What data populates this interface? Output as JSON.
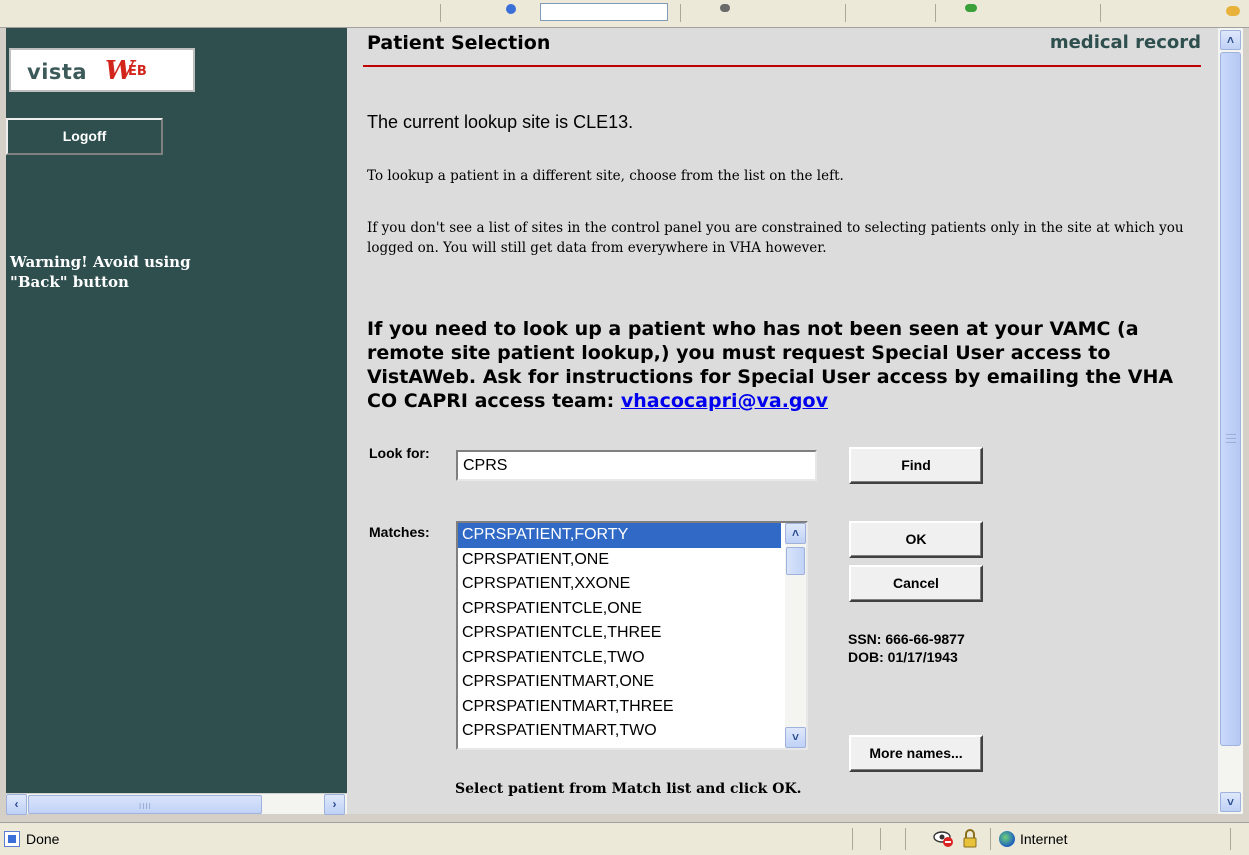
{
  "left_panel": {
    "logo": {
      "part1": "vista",
      "part2": "W",
      "part3": "EB"
    },
    "logoff_label": "Logoff",
    "warning_line1": "Warning! Avoid using",
    "warning_line2": "\"Back\" button"
  },
  "header": {
    "title": "Patient Selection",
    "right_label": "medical record"
  },
  "content": {
    "lookup_site": "The current lookup site is CLE13.",
    "paragraph1": "To lookup a patient in a different site, choose from the list on the left.",
    "paragraph2": "If you don't see a list of sites in the control panel you are constrained to selecting patients only in the site at which you logged on. You will still get data from everywhere in VHA however.",
    "paragraph3": "If you need to look up a patient who has not been seen at your VAMC (a remote site patient lookup,) you must request Special User access to VistAWeb. Ask for instructions for Special User access by emailing the VHA CO CAPRI access team: ",
    "email_link": "vhacocapri@va.gov"
  },
  "search": {
    "label": "Look for:",
    "value": "CPRS",
    "find_label": "Find"
  },
  "matches": {
    "label": "Matches:",
    "items": [
      "CPRSPATIENT,FORTY",
      "CPRSPATIENT,ONE",
      "CPRSPATIENT,XXONE",
      "CPRSPATIENTCLE,ONE",
      "CPRSPATIENTCLE,THREE",
      "CPRSPATIENTCLE,TWO",
      "CPRSPATIENTMART,ONE",
      "CPRSPATIENTMART,THREE",
      "CPRSPATIENTMART,TWO"
    ],
    "selected": "CPRSPATIENT,FORTY"
  },
  "buttons": {
    "ok_label": "OK",
    "cancel_label": "Cancel",
    "more_label": "More names..."
  },
  "patient_info": {
    "ssn": "SSN: 666-66-9877",
    "dob": "DOB: 01/17/1943"
  },
  "instruction": "Select patient from Match list and click OK.",
  "statusbar": {
    "status": "Done",
    "zone": "Internet"
  },
  "colors": {
    "left_panel_bg": "#2f4f4f",
    "content_bg": "#dcdcdc",
    "accent_red": "#c00000",
    "selection_blue": "#3169c6",
    "link_blue": "#0000ee"
  },
  "icons": {
    "status": "page-done-icon",
    "privacy": "privacy-eye-icon",
    "lock": "lock-icon",
    "zone": "globe-icon"
  }
}
